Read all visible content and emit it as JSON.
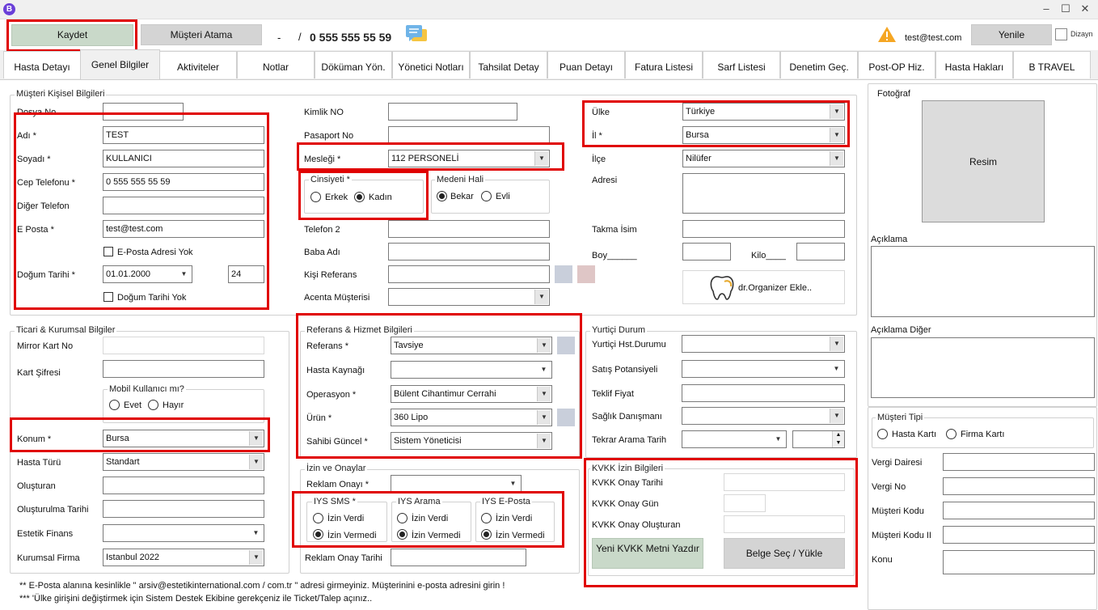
{
  "app": {
    "logo_letter": "B"
  },
  "window_controls": {
    "minimize": "‒",
    "maximize": "☐",
    "close": "✕"
  },
  "toolbar": {
    "save": "Kaydet",
    "assign_customer": "Müşteri Atama",
    "separator_dash": "-",
    "separator_slash": "/",
    "phone": "0 555 555 55 59",
    "email": "test@test.com",
    "refresh": "Yenile",
    "design": "Dizayn"
  },
  "tabs": [
    "Hasta Detayı",
    "Genel Bilgiler",
    "Aktiviteler",
    "Notlar",
    "Döküman Yön.",
    "Yönetici Notları",
    "Tahsilat Detay",
    "Puan Detayı",
    "Fatura Listesi",
    "Sarf Listesi",
    "Denetim Geç.",
    "Post-OP Hiz.",
    "Hasta Hakları",
    "B TRAVEL"
  ],
  "personal": {
    "title": "Müşteri Kişisel Bilgileri",
    "file_no_label": "Dosya No",
    "name_label": "Adı *",
    "name": "TEST",
    "surname_label": "Soyadı *",
    "surname": "KULLANICI",
    "mobile_label": "Cep Telefonu *",
    "mobile": "0 555 555 55 59",
    "other_phone_label": "Diğer Telefon",
    "email_label": "E Posta *",
    "email": "test@test.com",
    "no_email_label": "E-Posta Adresi Yok",
    "birth_label": "Doğum Tarihi *",
    "birth": "01.01.2000",
    "age": "24",
    "no_birth_label": "Doğum Tarihi Yok"
  },
  "identity": {
    "id_label": "Kimlik NO",
    "passport_label": "Pasaport No",
    "job_label": "Mesleği *",
    "job": "112 PERSONELİ",
    "gender_title": "Cinsiyeti  *",
    "male": "Erkek",
    "female": "Kadın",
    "marital_title": "Medeni Hali",
    "single": "Bekar",
    "married": "Evli",
    "phone2_label": "Telefon 2",
    "father_label": "Baba Adı",
    "person_ref_label": "Kişi Referans",
    "agency_label": "Acenta Müşterisi"
  },
  "address": {
    "country_label": "Ülke",
    "country": "Türkiye",
    "city_label": "İl *",
    "city": "Bursa",
    "district_label": "İlçe",
    "district": "Nilüfer",
    "address_label": "Adresi",
    "nickname_label": "Takma İsim",
    "height_label": "Boy______",
    "weight_label": "Kilo____",
    "organizer_button": "dr.Organizer Ekle.."
  },
  "photo": {
    "title": "Fotoğraf",
    "image_label": "Resim",
    "desc_label": "Açıklama",
    "desc_other_label": "Açıklama Diğer"
  },
  "corporate": {
    "title": "Ticari & Kurumsal Bilgiler",
    "mirror_label": "Mirror Kart No",
    "card_pw_label": "Kart Şifresi",
    "mobile_user_title": "Mobil Kullanıcı mı?",
    "yes": "Evet",
    "no": "Hayır",
    "location_label": "Konum *",
    "location": "Bursa",
    "patient_type_label": "Hasta Türü",
    "patient_type": "Standart",
    "creator_label": "Oluşturan",
    "created_date_label": "Oluşturulma Tarihi",
    "aesthetic_finance_label": "Estetik Finans",
    "corp_company_label": "Kurumsal Firma",
    "corp_company": "Istanbul 2022"
  },
  "reference": {
    "title": "Referans  & Hizmet Bilgileri",
    "ref_label": "Referans *",
    "ref": "Tavsiye",
    "source_label": "Hasta Kaynağı",
    "operation_label": "Operasyon *",
    "operation": "Bülent Cihantimur Cerrahi",
    "product_label": "Ürün *",
    "product": "360 Lipo",
    "owner_label": "Sahibi Güncel *",
    "owner": "Sistem Yöneticisi"
  },
  "domestic": {
    "title": "Yurtiçi Durum",
    "status_label": "Yurtiçi Hst.Durumu",
    "sales_label": "Satış Potansiyeli",
    "offer_label": "Teklif Fiyat",
    "advisor_label": "Sağlık Danışmanı",
    "recall_label": "Tekrar Arama Tarih"
  },
  "consent": {
    "title": "İzin ve Onaylar",
    "ad_consent_label": "Reklam Onayı *",
    "sms_title": "IYS SMS *",
    "call_title": "IYS Arama",
    "mail_title": "IYS E-Posta",
    "allow": "İzin Verdi",
    "deny": "İzin Vermedi",
    "ad_consent_date_label": "Reklam Onay Tarihi"
  },
  "kvkk": {
    "title": "KVKK İzin Bilgileri",
    "date_label": "KVKK Onay Tarihi",
    "day_label": "KVKK Onay Gün",
    "creator_label": "KVKK Onay Oluşturan",
    "print_button": "Yeni KVKK Metni Yazdır",
    "upload_button": "Belge Seç / Yükle"
  },
  "customer_type": {
    "title": "Müşteri Tipi",
    "patient_card": "Hasta Kartı",
    "company_card": "Firma Kartı",
    "tax_office_label": "Vergi Dairesi",
    "tax_no_label": "Vergi No",
    "code_label": "Müşteri Kodu",
    "code2_label": "Müşteri Kodu II",
    "topic_label": "Konu"
  },
  "notes": {
    "note1": "** E-Posta alanına kesinlikle \" arsiv@estetikinternational.com / com.tr \" adresi girmeyiniz. Müşterinini e-posta adresini girin !",
    "note2": "*** 'Ülke girişini değiştirmek için Sistem Destek Ekibine gerekçeniz ile Ticket/Talep açınız.."
  },
  "colors": {
    "highlight": "#e00000",
    "save_green": "#c9d9c9",
    "warning": "#f5a623",
    "chat_blue": "#6fb4e8"
  }
}
